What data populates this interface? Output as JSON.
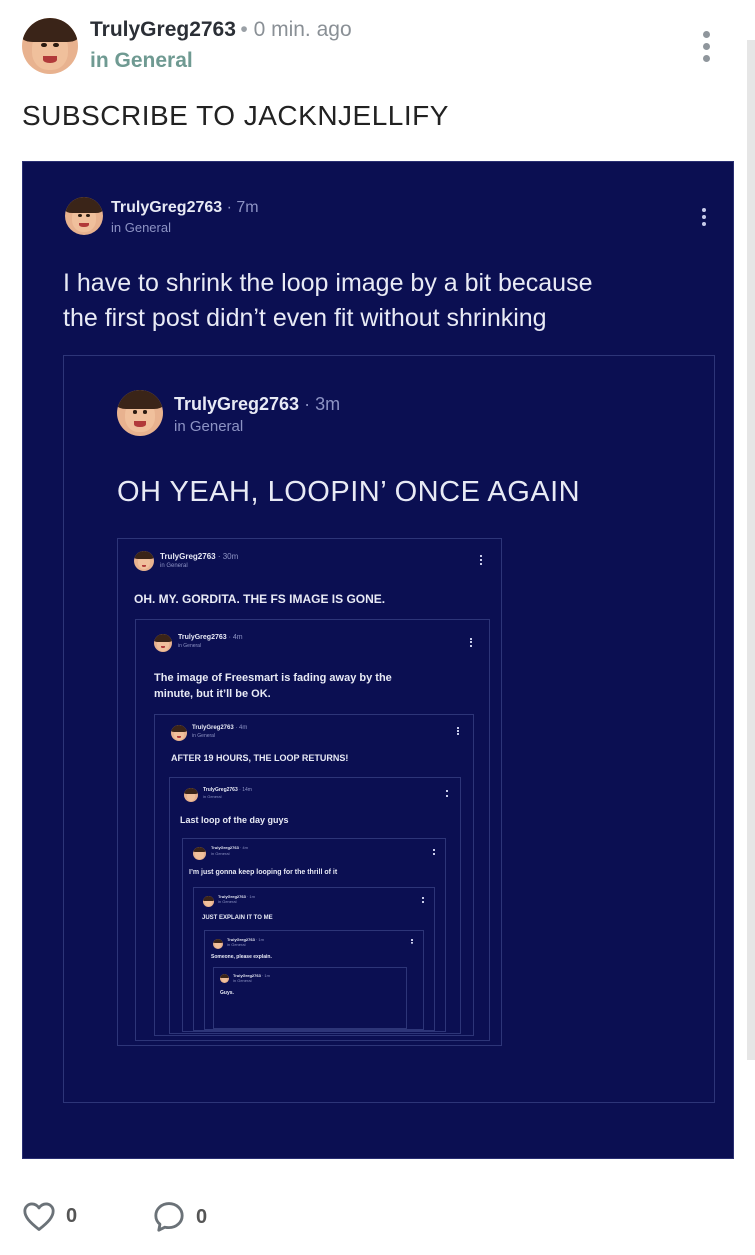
{
  "post": {
    "username": "TrulyGreg2763",
    "time": "0 min. ago",
    "channel": "in General",
    "text": "SUBSCRIBE TO JACKNJELLIFY",
    "likes": "0",
    "comments": "0"
  },
  "embedded": {
    "level1": {
      "username": "TrulyGreg2763",
      "time": "7m",
      "channel": "in General",
      "text_line1": "I have to shrink the loop image by a bit because",
      "text_line2": "the first post didn’t even fit without shrinking"
    },
    "level2": {
      "username": "TrulyGreg2763",
      "time": "3m",
      "channel": "in General",
      "text": "OH YEAH, LOOPIN’ ONCE AGAIN"
    },
    "level3": {
      "username": "TrulyGreg2763",
      "time": "30m",
      "channel": "in General",
      "text": "OH. MY. GORDITA. THE FS IMAGE IS GONE."
    },
    "level4": {
      "username": "TrulyGreg2763",
      "time": "4m",
      "channel": "in General",
      "text_line1": "The image of Freesmart is fading away by the",
      "text_line2": "minute, but it’ll be OK."
    },
    "level5": {
      "username": "TrulyGreg2763",
      "time": "4m",
      "channel": "in General",
      "text": "AFTER 19 HOURS, THE LOOP RETURNS!"
    },
    "level6": {
      "username": "TrulyGreg2763",
      "time": "14m",
      "channel": "in General",
      "text": "Last loop of the day guys"
    },
    "level7": {
      "username": "TrulyGreg2763",
      "time": "4m",
      "channel": "in General",
      "text": "I’m just gonna keep looping for the thrill of it"
    },
    "level8": {
      "username": "TrulyGreg2763",
      "time": "1m",
      "channel": "in General",
      "text": "JUST EXPLAIN IT TO ME"
    },
    "level9": {
      "username": "TrulyGreg2763",
      "time": "1m",
      "channel": "in General",
      "text": "Someone, please explain."
    },
    "level10": {
      "username": "TrulyGreg2763",
      "time": "1m",
      "channel": "in General",
      "text": "Guys."
    }
  },
  "icons": {
    "more": "kebab-icon",
    "like": "heart-icon",
    "comment": "comment-icon"
  },
  "colors": {
    "screenshot_bg": "#0b0f52",
    "channel": "#6f9a92",
    "username": "#2b2f36"
  }
}
